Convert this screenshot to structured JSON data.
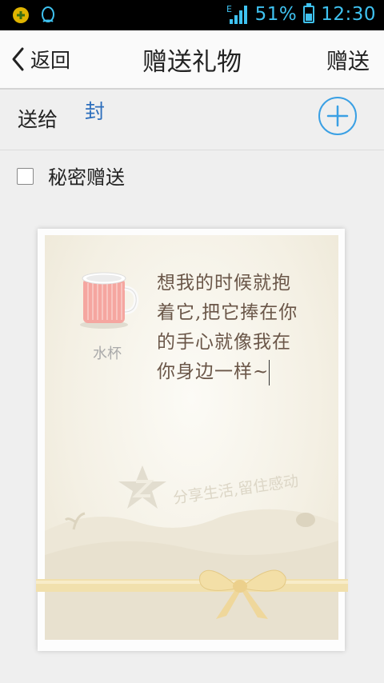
{
  "status_bar": {
    "signal_label": "E",
    "battery_percent": "51%",
    "battery_level": 0.51,
    "time": "12:30"
  },
  "header": {
    "back_label": "返回",
    "title": "赠送礼物",
    "send_label": "赠送"
  },
  "recipient": {
    "to_label": "送给",
    "name": "封"
  },
  "options": {
    "secret_send_label": "秘密赠送",
    "secret_send_checked": false
  },
  "card": {
    "gift_name": "水杯",
    "message": "想我的时候就抱着它,把它捧在你的手心就像我在你身边一样~",
    "watermark_text": "分享生活,留住感动"
  }
}
